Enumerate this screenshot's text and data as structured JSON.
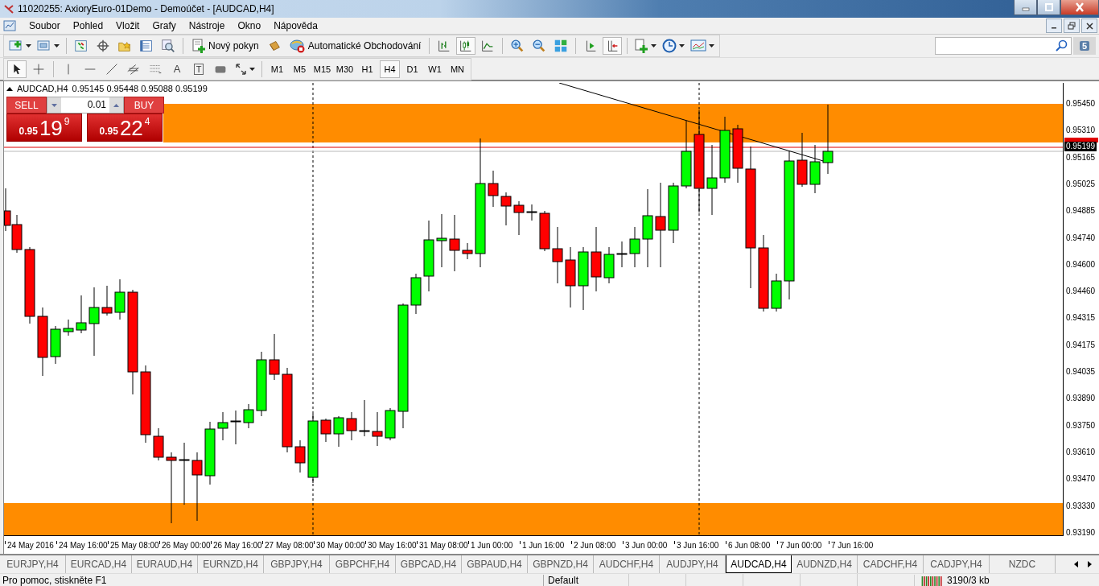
{
  "window": {
    "title": "11020255: AxioryEuro-01Demo - Demoúčet - [AUDCAD,H4]"
  },
  "menu": [
    "Soubor",
    "Pohled",
    "Vložit",
    "Grafy",
    "Nástroje",
    "Okno",
    "Nápověda"
  ],
  "toolbar": {
    "new_order": "Nový pokyn",
    "auto_trading": "Automatické Obchodování"
  },
  "drawing_tools": {
    "text": "A",
    "label": "T"
  },
  "timeframes": [
    {
      "label": "M1",
      "selected": false
    },
    {
      "label": "M5",
      "selected": false
    },
    {
      "label": "M15",
      "selected": false
    },
    {
      "label": "M30",
      "selected": false
    },
    {
      "label": "H1",
      "selected": false
    },
    {
      "label": "H4",
      "selected": true
    },
    {
      "label": "D1",
      "selected": false
    },
    {
      "label": "W1",
      "selected": false
    },
    {
      "label": "MN",
      "selected": false
    }
  ],
  "notifications": {
    "count": "5"
  },
  "chart": {
    "header": {
      "symbol": "AUDCAD,H4",
      "prices": "0.95145 0.95448 0.95088 0.95199"
    },
    "one_click": {
      "sell": "SELL",
      "buy": "BUY",
      "lot": "0.01",
      "sell_price": {
        "prefix": "0.95",
        "big": "19",
        "small": "9"
      },
      "buy_price": {
        "prefix": "0.95",
        "big": "22",
        "small": "4"
      }
    },
    "price_axis": [
      "0.95450",
      "0.95310",
      "0.95165",
      "0.95025",
      "0.94885",
      "0.94740",
      "0.94600",
      "0.94460",
      "0.94315",
      "0.94175",
      "0.94035",
      "0.93890",
      "0.93750",
      "0.93610",
      "0.93470",
      "0.93330",
      "0.93190"
    ],
    "current_price": "0.95199",
    "time_axis": [
      "24 May 2016",
      "24 May 16:00",
      "25 May 08:00",
      "26 May 00:00",
      "26 May 16:00",
      "27 May 08:00",
      "30 May 00:00",
      "30 May 16:00",
      "31 May 08:00",
      "1 Jun 00:00",
      "1 Jun 16:00",
      "2 Jun 08:00",
      "3 Jun 00:00",
      "3 Jun 16:00",
      "6 Jun 08:00",
      "7 Jun 00:00",
      "7 Jun 16:00"
    ]
  },
  "tabs": [
    {
      "label": "EURJPY,H4",
      "selected": false
    },
    {
      "label": "EURCAD,H4",
      "selected": false
    },
    {
      "label": "EURAUD,H4",
      "selected": false
    },
    {
      "label": "EURNZD,H4",
      "selected": false
    },
    {
      "label": "GBPJPY,H4",
      "selected": false
    },
    {
      "label": "GBPCHF,H4",
      "selected": false
    },
    {
      "label": "GBPCAD,H4",
      "selected": false
    },
    {
      "label": "GBPAUD,H4",
      "selected": false
    },
    {
      "label": "GBPNZD,H4",
      "selected": false
    },
    {
      "label": "AUDCHF,H4",
      "selected": false
    },
    {
      "label": "AUDJPY,H4",
      "selected": false
    },
    {
      "label": "AUDCAD,H4",
      "selected": true
    },
    {
      "label": "AUDNZD,H4",
      "selected": false
    },
    {
      "label": "CADCHF,H4",
      "selected": false
    },
    {
      "label": "CADJPY,H4",
      "selected": false
    },
    {
      "label": "NZDC",
      "selected": false
    }
  ],
  "status_bar": {
    "help": "Pro pomoc, stiskněte F1",
    "profile": "Default",
    "traffic": "3190/3 kb"
  }
}
